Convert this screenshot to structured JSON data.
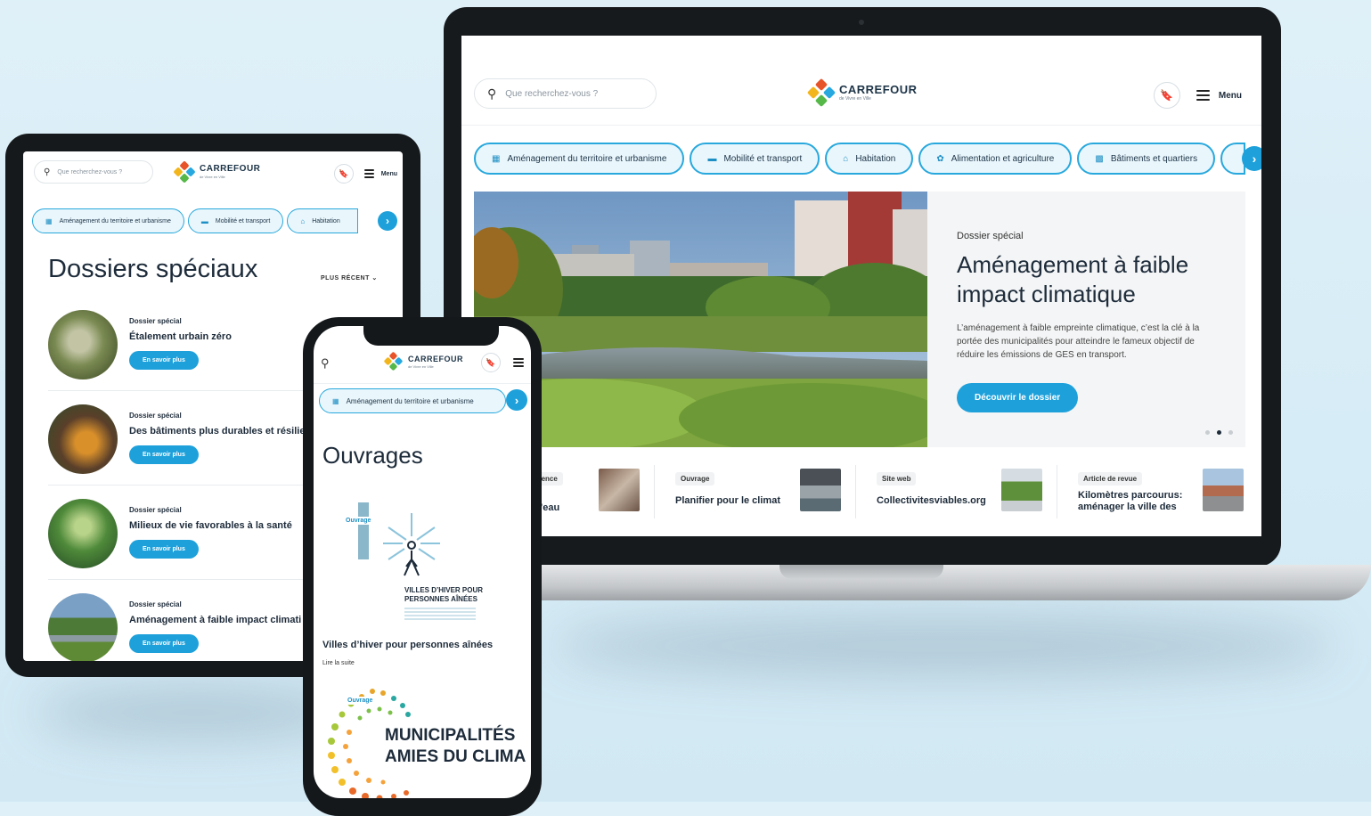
{
  "colors": {
    "accent": "#1ea1db",
    "accent_light": "#e9f6fc",
    "text_dark": "#1d2b3a"
  },
  "brand": {
    "name": "CARREFOUR",
    "tagline": "de Vivre en Ville"
  },
  "laptop": {
    "search_placeholder": "Que recherchez-vous ?",
    "menu_label": "Menu",
    "categories": [
      "Aménagement du territoire et urbanisme",
      "Mobilité et transport",
      "Habitation",
      "Alimentation et agriculture",
      "Bâtiments et quartiers"
    ],
    "hero": {
      "kicker": "Dossier spécial",
      "title": "Aménagement à faible impact climatique",
      "description": "L’aménagement à faible empreinte climatique, c’est la clé à la portée des municipalités pour atteindre le fameux objectif de réduire les émissions de GES en transport.",
      "button": "Découvrir le dossier",
      "slide_count": 3,
      "active_slide": 2
    },
    "cards": [
      {
        "tag": "érence",
        "title": "c l’eau"
      },
      {
        "tag": "Ouvrage",
        "title": "Planifier pour le climat"
      },
      {
        "tag": "Site web",
        "title": "Collectivitesviables.org"
      },
      {
        "tag": "Article de revue",
        "title": "Kilomètres parcourus: aménager la ville des"
      }
    ]
  },
  "tablet": {
    "search_placeholder": "Que recherchez-vous ?",
    "menu_label": "Menu",
    "categories": [
      "Aménagement du territoire et urbanisme",
      "Mobilité et transport",
      "Habitation"
    ],
    "heading": "Dossiers spéciaux",
    "sort_label": "PLUS RÉCENT",
    "items": [
      {
        "kicker": "Dossier spécial",
        "title": "Étalement urbain zéro",
        "button": "En savoir plus"
      },
      {
        "kicker": "Dossier spécial",
        "title": "Des bâtiments plus durables et résilie",
        "button": "En savoir plus"
      },
      {
        "kicker": "Dossier spécial",
        "title": "Milieux de vie favorables à la santé",
        "button": "En savoir plus"
      },
      {
        "kicker": "Dossier spécial",
        "title": "Aménagement à faible impact climati",
        "button": "En savoir plus"
      }
    ]
  },
  "phone": {
    "category": "Aménagement du territoire et urbanisme",
    "heading": "Ouvrages",
    "book1": {
      "tag": "Ouvrage",
      "cover_text": "VILLES D’HIVER POUR PERSONNES AÎNÉES",
      "title": "Villes d’hiver pour personnes aînées",
      "link": "Lire la suite"
    },
    "book2": {
      "tag": "Ouvrage",
      "cover_line1": "MUNICIPALITÉS",
      "cover_line2": "AMIES DU CLIMA"
    }
  }
}
